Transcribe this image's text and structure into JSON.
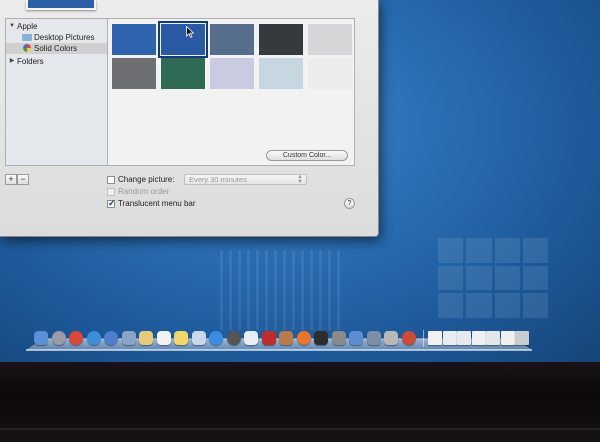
{
  "window": {
    "sidebar": {
      "groups": [
        {
          "label": "Apple",
          "expanded": true,
          "items": [
            {
              "label": "Desktop Pictures",
              "icon": "folder-icon",
              "selected": false
            },
            {
              "label": "Solid Colors",
              "icon": "color-wheel-icon",
              "selected": true
            }
          ]
        },
        {
          "label": "Folders",
          "expanded": false,
          "items": []
        }
      ],
      "add_label": "+",
      "remove_label": "−"
    },
    "swatches": [
      {
        "color": "#2f63ad",
        "selected": false
      },
      {
        "color": "#2b5aa4",
        "selected": true
      },
      {
        "color": "#566d8c",
        "selected": false
      },
      {
        "color": "#36393d",
        "selected": false
      },
      {
        "color": "#d6d6d8",
        "selected": false
      },
      {
        "color": "#6e6f72",
        "selected": false
      },
      {
        "color": "#2f6a54",
        "selected": false
      },
      {
        "color": "#c9cbe0",
        "selected": false
      },
      {
        "color": "#c7d7e2",
        "selected": false
      },
      {
        "color": "#ececec",
        "selected": false
      }
    ],
    "custom_color_label": "Custom Color...",
    "options": {
      "change_picture": {
        "label": "Change picture:",
        "checked": false,
        "enabled": true
      },
      "interval": {
        "value": "Every 30 minutes"
      },
      "random_order": {
        "label": "Random order",
        "checked": false,
        "enabled": false
      },
      "translucent_menu_bar": {
        "label": "Translucent menu bar",
        "checked": true,
        "enabled": true
      }
    },
    "help_label": "?"
  },
  "dock": {
    "apps": [
      {
        "name": "finder-icon",
        "color": "#5b8fd6",
        "round": false
      },
      {
        "name": "launchpad-icon",
        "color": "#9a9aa8",
        "round": true
      },
      {
        "name": "chrome-icon",
        "color": "#d9483b",
        "round": true
      },
      {
        "name": "safari-icon",
        "color": "#3d8fd9",
        "round": true
      },
      {
        "name": "itunes-icon",
        "color": "#4e7fcf",
        "round": true
      },
      {
        "name": "mail-icon",
        "color": "#8aa4c8",
        "round": false
      },
      {
        "name": "notes-icon",
        "color": "#e7c97a",
        "round": false
      },
      {
        "name": "calendar-icon",
        "color": "#f2f2f2",
        "round": false
      },
      {
        "name": "stickies-icon",
        "color": "#f1d76a",
        "round": false
      },
      {
        "name": "preview-icon",
        "color": "#c9d8e6",
        "round": false
      },
      {
        "name": "app-store-icon",
        "color": "#3a8de0",
        "round": true
      },
      {
        "name": "camera-icon",
        "color": "#555",
        "round": true
      },
      {
        "name": "itunes-icon-2",
        "color": "#e8eef6",
        "round": false
      },
      {
        "name": "photobooth-icon",
        "color": "#c02b2b",
        "round": false
      },
      {
        "name": "address-book-icon",
        "color": "#b97a4a",
        "round": false
      },
      {
        "name": "firefox-icon",
        "color": "#e8742d",
        "round": true
      },
      {
        "name": "activity-monitor-icon",
        "color": "#2d2d2d",
        "round": false
      },
      {
        "name": "system-preferences-icon",
        "color": "#8a8a8a",
        "round": false
      },
      {
        "name": "xcode-icon",
        "color": "#5a8ed0",
        "round": false
      },
      {
        "name": "utilities-icon",
        "color": "#7f8fa3",
        "round": false
      },
      {
        "name": "script-editor-icon",
        "color": "#b8b8b8",
        "round": false
      },
      {
        "name": "dashboard-icon",
        "color": "#d04a3a",
        "round": true
      }
    ],
    "stacks": [
      {
        "name": "document-icon",
        "color": "#f1f1f1"
      },
      {
        "name": "window-icon-1",
        "color": "#e8ecf2"
      },
      {
        "name": "window-icon-2",
        "color": "#e6e9ee"
      },
      {
        "name": "window-icon-3",
        "color": "#eef0f3"
      },
      {
        "name": "window-icon-4",
        "color": "#e3e7ec"
      },
      {
        "name": "window-icon-5",
        "color": "#f0f0f0"
      },
      {
        "name": "trash-icon",
        "color": "#c9ccd1"
      }
    ]
  }
}
